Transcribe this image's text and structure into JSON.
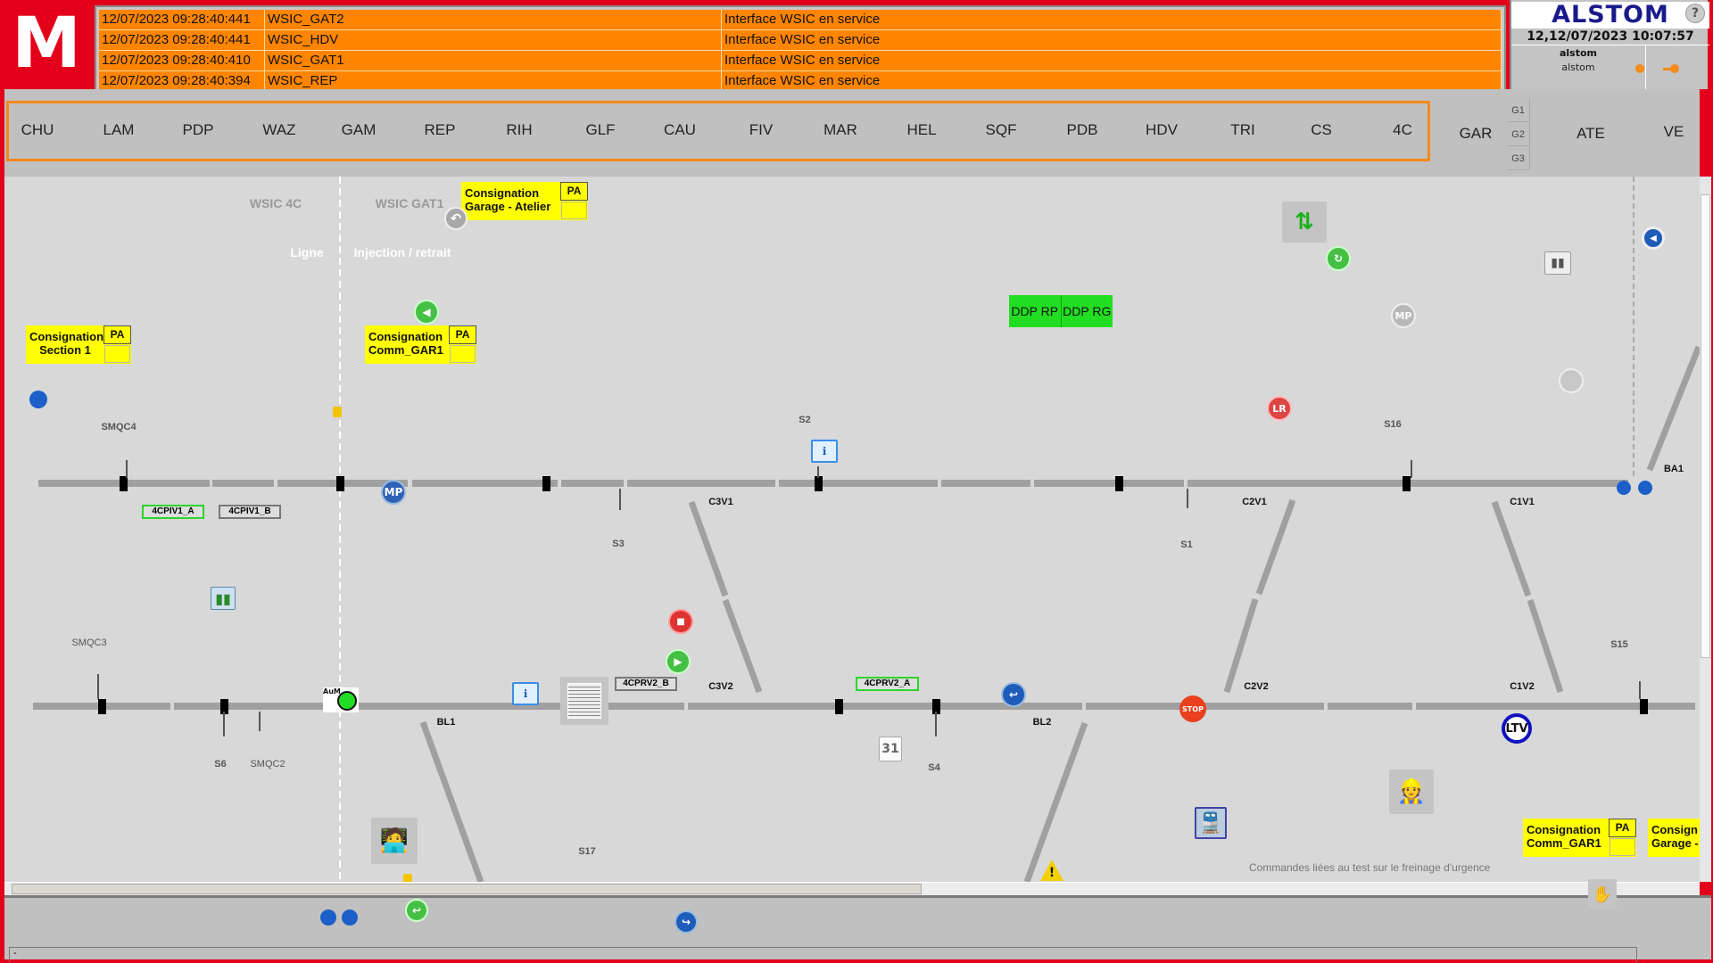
{
  "logo": "M",
  "alarms": [
    {
      "time": "12/07/2023 09:28:40:441",
      "code": "WSIC_GAT2",
      "message": "Interface WSIC en service"
    },
    {
      "time": "12/07/2023 09:28:40:441",
      "code": "WSIC_HDV",
      "message": "Interface WSIC en service"
    },
    {
      "time": "12/07/2023 09:28:40:410",
      "code": "WSIC_GAT1",
      "message": "Interface WSIC en service"
    },
    {
      "time": "12/07/2023 09:28:40:394",
      "code": "WSIC_REP",
      "message": "Interface WSIC en service"
    }
  ],
  "header": {
    "brand": "ALSTOM",
    "help": "?",
    "clock": "12,12/07/2023 10:07:57",
    "user_name": "alstom",
    "user_role": "alstom"
  },
  "stations": [
    "CHU",
    "LAM",
    "PDP",
    "WAZ",
    "GAM",
    "REP",
    "RIH",
    "GLF",
    "CAU",
    "FIV",
    "MAR",
    "HEL",
    "SQF",
    "PDB",
    "HDV",
    "TRI",
    "CS",
    "4C"
  ],
  "nav_right": {
    "gar": "GAR",
    "g1": "G1",
    "g2": "G2",
    "g3": "G3",
    "ate": "ATE",
    "ve": "VE"
  },
  "map": {
    "zones": {
      "wsic_4c": "WSIC 4C",
      "wsic_gat1": "WSIC GAT1",
      "ligne": "Ligne",
      "injection": "Injection / retrait"
    },
    "consignations": [
      {
        "l1": "Consignation",
        "l2": "Garage - Atelier",
        "pa": "PA"
      },
      {
        "l1": "Consignation",
        "l2": "Section 1",
        "pa": "PA"
      },
      {
        "l1": "Consignation",
        "l2": "Comm_GAR1",
        "pa": "PA"
      },
      {
        "l1": "Consignation",
        "l2": "Comm_GAR1",
        "pa": "PA"
      },
      {
        "l1": "Consign",
        "l2": "Garage -"
      }
    ],
    "ddp": [
      "DDP RP",
      "DDP RG"
    ],
    "track_boxes": [
      "4CPIV1_A",
      "4CPIV1_B",
      "4CPRV2_B",
      "4CPRV2_A"
    ],
    "labels": [
      "SMQC4",
      "S2",
      "S16",
      "BA1",
      "C3V1",
      "C2V1",
      "C1V1",
      "S3",
      "S1",
      "SMQC3",
      "S15",
      "C3V2",
      "C2V2",
      "C1V2",
      "BL1",
      "BL2",
      "S6",
      "SMQC2",
      "S4",
      "S17"
    ],
    "icons": {
      "mp": "MP",
      "lr": "LR",
      "ltv": "LTV",
      "stop": "STOP",
      "aum": "AuM",
      "calendar": "31"
    },
    "note": "Commandes liées au test sur le freinage d'urgence"
  },
  "status_bar": "-",
  "colors": {
    "alarm": "#ff8500",
    "brand_red": "#e4001b",
    "consignation": "#ffff00",
    "ddp": "#22dd22",
    "station_border": "#f08a1c"
  }
}
